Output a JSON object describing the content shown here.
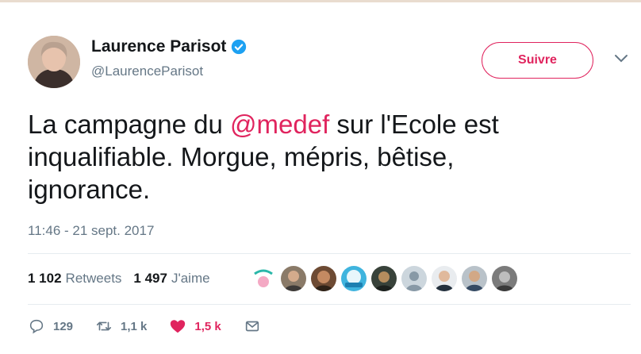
{
  "author": {
    "name": "Laurence Parisot",
    "handle": "@LaurenceParisot"
  },
  "follow_label": "Suivre",
  "tweet": {
    "text_before": "La campagne du ",
    "mention": "@medef",
    "text_after": " sur l'Ecole est inqualifiable. Morgue, mépris, bêtise, ignorance."
  },
  "timestamp": "11:46 - 21 sept. 2017",
  "stats": {
    "retweets_count": "1 102",
    "retweets_label": "Retweets",
    "likes_count": "1 497",
    "likes_label": "J'aime"
  },
  "actions": {
    "reply_count": "129",
    "retweet_count": "1,1 k",
    "like_count": "1,5 k"
  },
  "colors": {
    "accent": "#e0245e",
    "verified": "#1da1f2",
    "muted": "#657786"
  },
  "icons": [
    "verified-badge-icon",
    "chevron-down-icon",
    "reply-icon",
    "retweet-icon",
    "heart-icon",
    "message-icon"
  ]
}
